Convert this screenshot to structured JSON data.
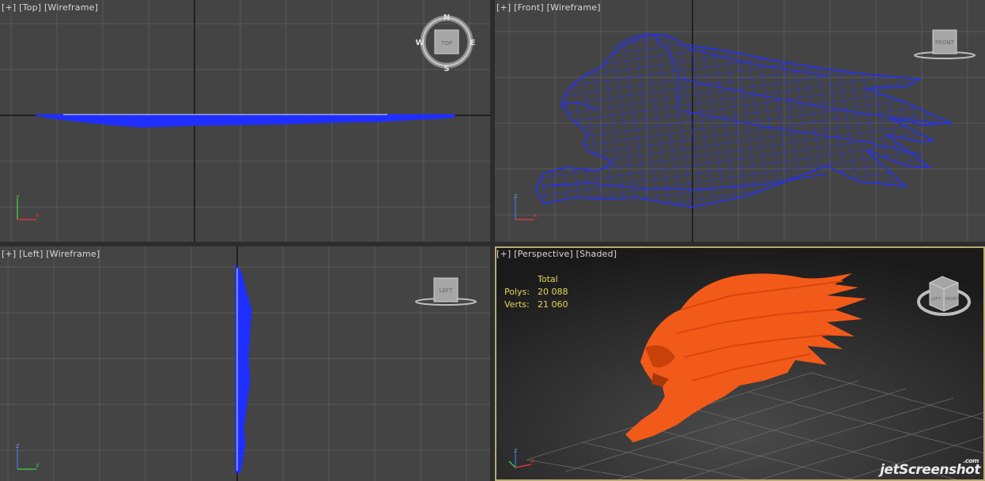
{
  "viewports": {
    "top": {
      "label": "[+] [Top] [Wireframe]",
      "compass": {
        "n": "N",
        "s": "S",
        "e": "E",
        "w": "W",
        "cube_face": "TOP"
      }
    },
    "front": {
      "label": "[+] [Front] [Wireframe]",
      "cube_face": "FRONT"
    },
    "left": {
      "label": "[+] [Left] [Wireframe]",
      "cube_face": "LEFT"
    },
    "perspective": {
      "label": "[+] [Perspective] [Shaded]",
      "stats": {
        "header": "Total",
        "polys_label": "Polys:",
        "polys_value": "20 088",
        "verts_label": "Verts:",
        "verts_value": "21 060"
      },
      "cube_faces": [
        "LEFT",
        "FRONT"
      ]
    }
  },
  "axis_labels": {
    "x": "x",
    "y": "y",
    "z": "z"
  },
  "watermark": {
    "text": "jetScreenshot",
    "suffix": ".com"
  },
  "colors": {
    "viewport_bg": "#444444",
    "grid": "#595959",
    "home_grid": "#0a0a0a",
    "wireframe": "#1f2fff",
    "shaded_model": "#f25a1a",
    "active_border": "#b9aa74",
    "stats_text": "#e8d65a"
  }
}
